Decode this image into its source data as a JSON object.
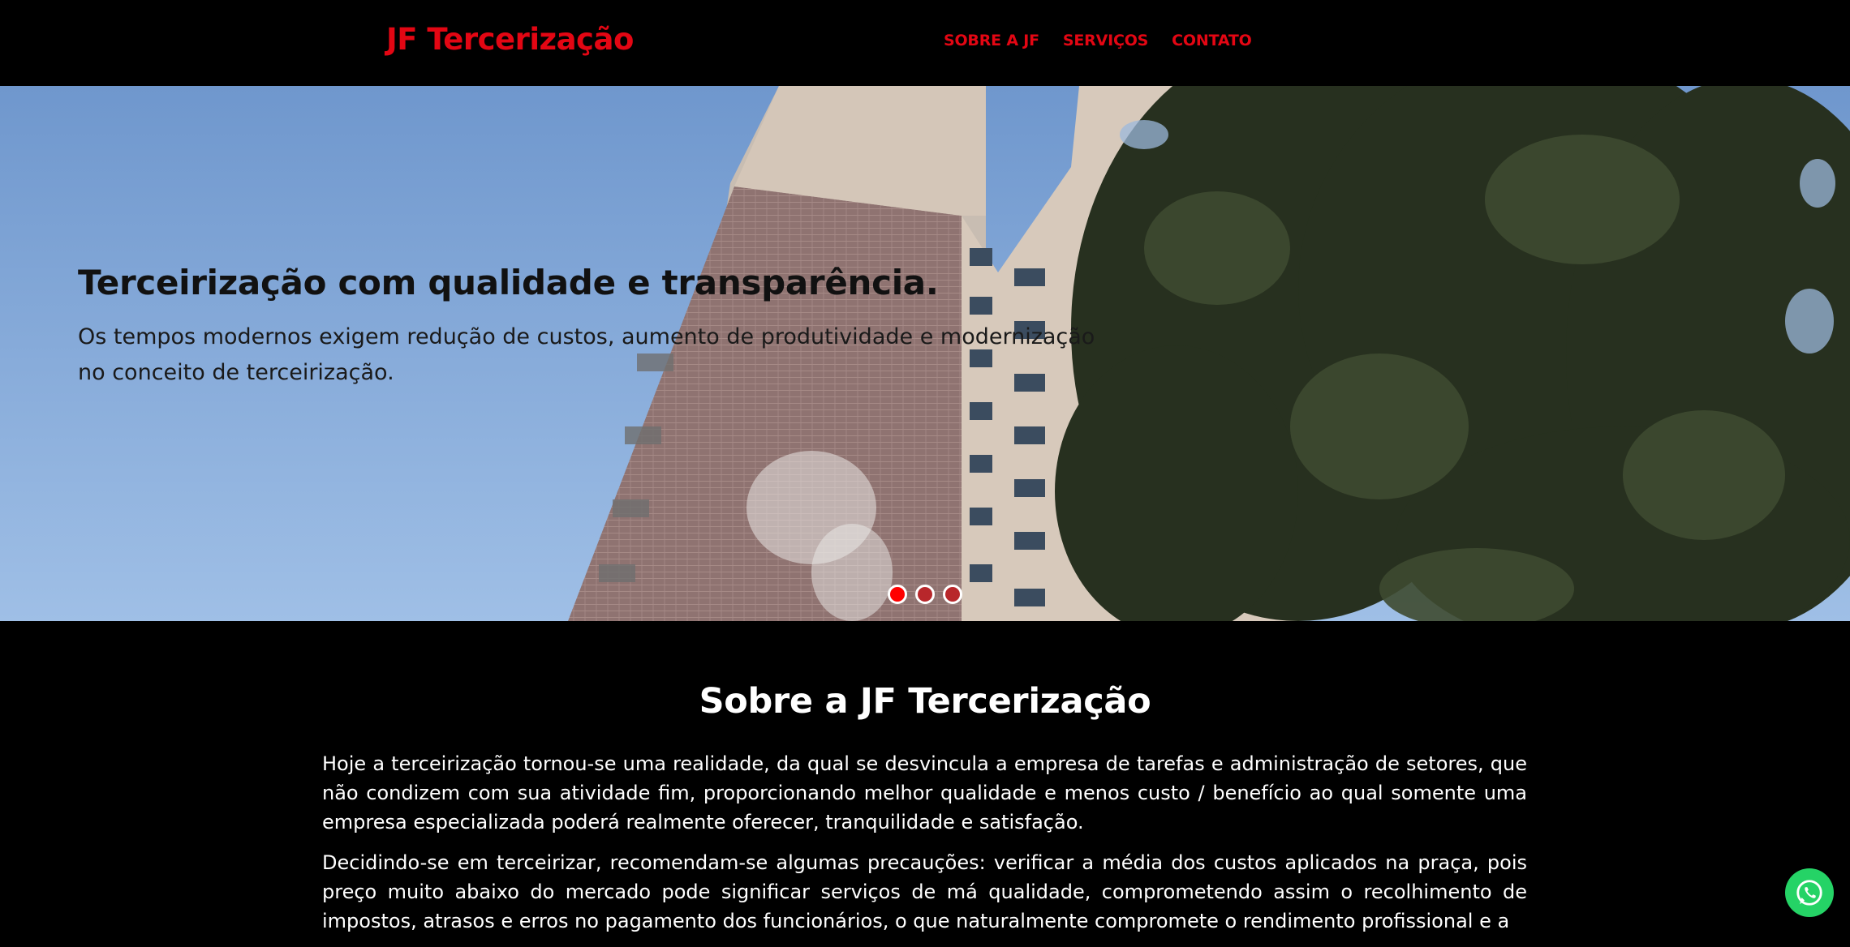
{
  "header": {
    "brand": "JF Tercerização",
    "nav": [
      "SOBRE A JF",
      "SERVIÇOS",
      "CONTATO"
    ]
  },
  "hero": {
    "title": "Terceirização com qualidade e transparência.",
    "text": "Os tempos modernos exigem redução de custos, aumento de produtividade e modernização no conceito de terceirização.",
    "slides": 3,
    "active_slide": 1,
    "image_description_icon": "building-facade-photo"
  },
  "about": {
    "title": "Sobre a JF Tercerização",
    "paragraphs": [
      "Hoje a terceirização tornou-se uma realidade, da qual se desvincula a empresa de tarefas e administração de setores, que não condizem com sua atividade fim, proporcionando melhor qualidade e menos custo / benefício ao qual somente uma empresa especializada poderá realmente oferecer, tranquilidade e satisfação.",
      "Decidindo-se em terceirizar, recomendam-se algumas precauções: verificar a média dos custos aplicados na praça, pois preço muito abaixo do mercado pode significar serviços de má qualidade, comprometendo assim o recolhimento de impostos, atrasos e erros no pagamento dos funcionários, o que naturalmente compromete o rendimento profissional e a"
    ]
  },
  "floating": {
    "icon": "whatsapp-icon"
  },
  "colors": {
    "brand_red": "#e30613",
    "background": "#000000",
    "whatsapp_green": "#25d366"
  }
}
